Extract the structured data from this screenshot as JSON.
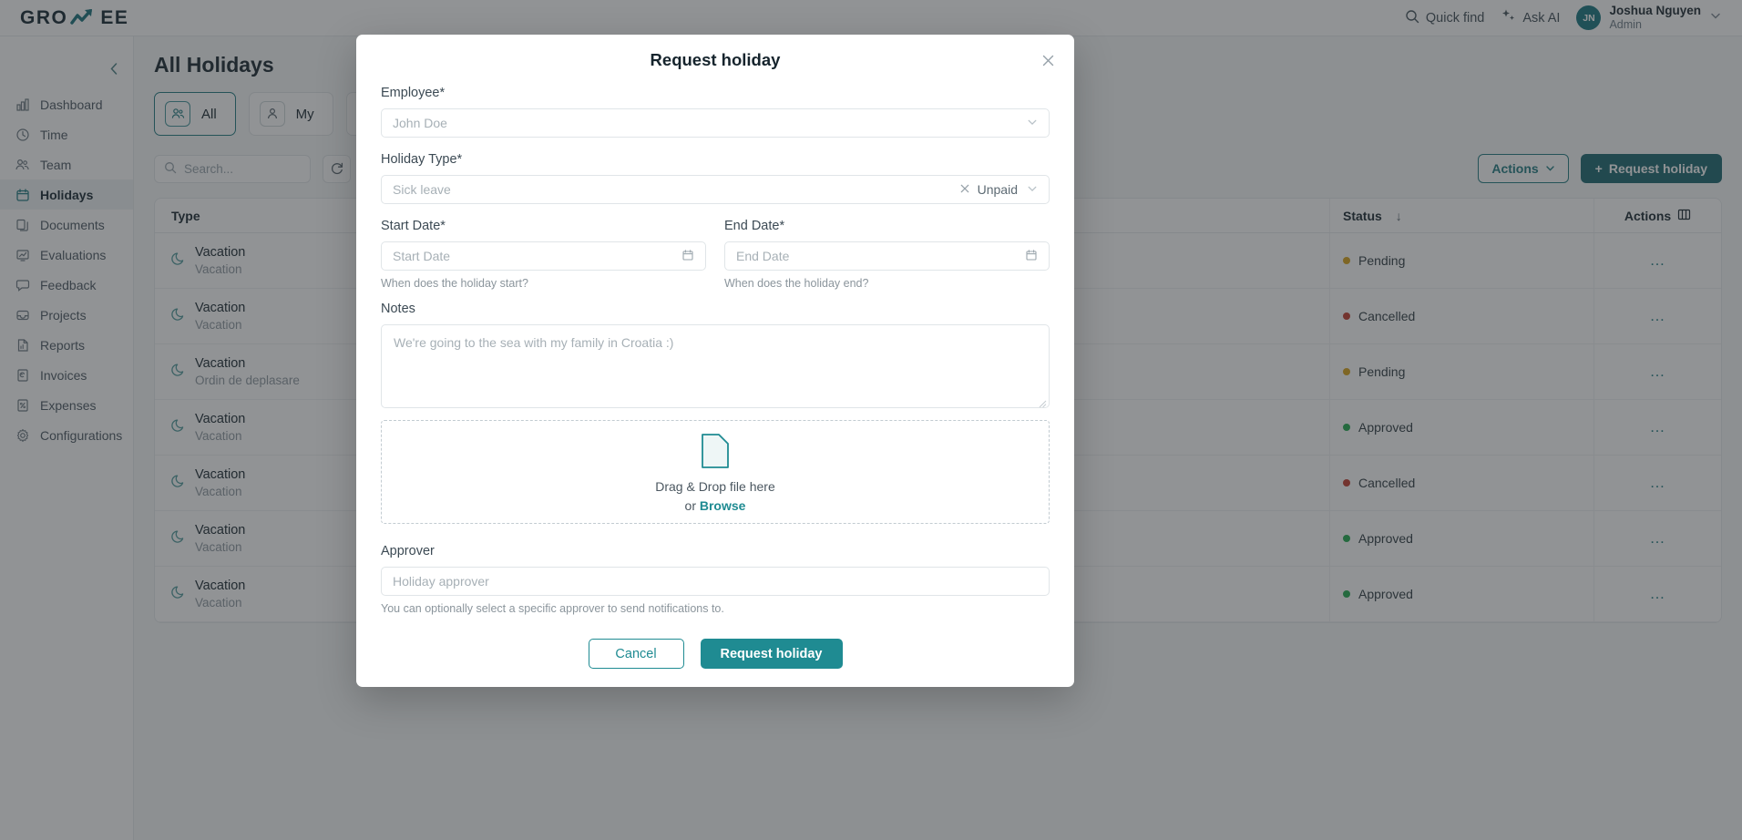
{
  "topbar": {
    "logo_left": "GRO",
    "logo_right": "EE",
    "quick_find": "Quick find",
    "ask_ai": "Ask AI",
    "avatar_initials": "JN",
    "user_name": "Joshua Nguyen",
    "user_role": "Admin"
  },
  "sidebar": {
    "items": [
      {
        "label": "Dashboard",
        "icon": "bar-chart-icon"
      },
      {
        "label": "Time",
        "icon": "clock-icon"
      },
      {
        "label": "Team",
        "icon": "people-icon"
      },
      {
        "label": "Holidays",
        "icon": "calendar-icon"
      },
      {
        "label": "Documents",
        "icon": "documents-icon"
      },
      {
        "label": "Evaluations",
        "icon": "evaluations-icon"
      },
      {
        "label": "Feedback",
        "icon": "chat-icon"
      },
      {
        "label": "Projects",
        "icon": "inbox-icon"
      },
      {
        "label": "Reports",
        "icon": "report-icon"
      },
      {
        "label": "Invoices",
        "icon": "invoice-icon"
      },
      {
        "label": "Expenses",
        "icon": "expenses-icon"
      },
      {
        "label": "Configurations",
        "icon": "gear-icon"
      }
    ],
    "active_index": 3
  },
  "page": {
    "title": "All Holidays",
    "tabs": [
      {
        "label": "All",
        "icon": "people-icon",
        "active": true
      },
      {
        "label": "My",
        "icon": "person-icon",
        "active": false
      },
      {
        "label": "",
        "icon": "calendar-icon",
        "active": false
      }
    ],
    "search_placeholder": "Search...",
    "refresh_icon": "refresh-icon",
    "filter_icon": "filter-icon",
    "actions_label": "Actions",
    "request_holiday_label": "Request holiday",
    "request_holiday_plus": "+"
  },
  "table": {
    "columns": [
      {
        "key": "type",
        "label": "Type"
      },
      {
        "key": "status",
        "label": "Status",
        "sort": "↓"
      },
      {
        "key": "actions",
        "label": "Actions",
        "icon": "columns-icon"
      }
    ],
    "rows": [
      {
        "type": "Vacation",
        "subtype": "Vacation",
        "status": "Pending",
        "status_color": "#d8a215",
        "actions": "…"
      },
      {
        "type": "Vacation",
        "subtype": "Vacation",
        "status": "Cancelled",
        "status_color": "#c0392b",
        "actions": "…"
      },
      {
        "type": "Vacation",
        "subtype": "Ordin de deplasare",
        "status": "Pending",
        "status_color": "#d8a215",
        "actions": "…"
      },
      {
        "type": "Vacation",
        "subtype": "Vacation",
        "status": "Approved",
        "status_color": "#1faa4b",
        "actions": "…"
      },
      {
        "type": "Vacation",
        "subtype": "Vacation",
        "status": "Cancelled",
        "status_color": "#c0392b",
        "actions": "…"
      },
      {
        "type": "Vacation",
        "subtype": "Vacation",
        "status": "Approved",
        "status_color": "#1faa4b",
        "actions": "…"
      },
      {
        "type": "Vacation",
        "subtype": "Vacation",
        "status": "Approved",
        "status_color": "#1faa4b",
        "actions": "…"
      }
    ]
  },
  "modal": {
    "title": "Request holiday",
    "close_icon": "close-icon",
    "employee": {
      "label": "Employee*",
      "placeholder": "John Doe",
      "value": ""
    },
    "holiday_type": {
      "label": "Holiday Type*",
      "placeholder": "Sick leave",
      "value": "",
      "tag": "Unpaid",
      "clear_icon": "close-icon"
    },
    "start_date": {
      "label": "Start Date*",
      "placeholder": "Start Date",
      "value": "",
      "hint": "When does the holiday start?",
      "icon": "calendar-icon"
    },
    "end_date": {
      "label": "End Date*",
      "placeholder": "End Date",
      "value": "",
      "hint": "When does the holiday end?",
      "icon": "calendar-icon"
    },
    "notes": {
      "label": "Notes",
      "placeholder": "We're going to the sea with my family in Croatia :)",
      "value": ""
    },
    "dropzone": {
      "icon": "file-icon",
      "text": "Drag & Drop file here",
      "or": "or ",
      "browse": "Browse"
    },
    "approver": {
      "label": "Approver",
      "placeholder": "Holiday approver",
      "value": "",
      "hint": "You can optionally select a specific approver to send notifications to."
    },
    "cancel_label": "Cancel",
    "submit_label": "Request holiday"
  },
  "colors": {
    "brand_teal": "#1f8b92",
    "brand_dark": "#17656e",
    "pending": "#d8a215",
    "approved": "#1faa4b",
    "cancelled": "#c0392b"
  }
}
